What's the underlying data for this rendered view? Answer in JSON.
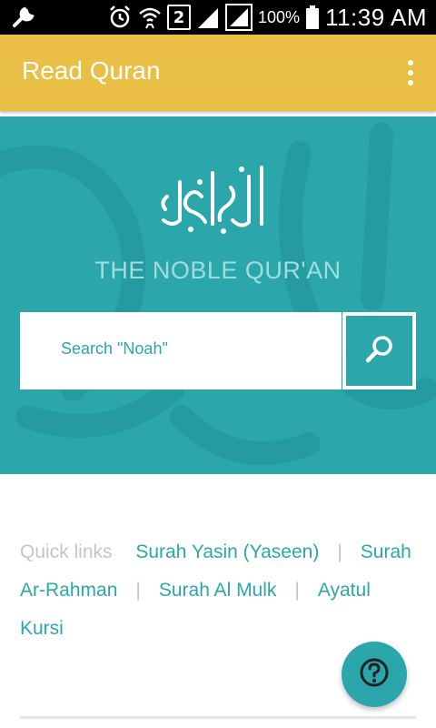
{
  "status_bar": {
    "battery": "100%",
    "time": "11:39 AM",
    "sim_badge": "2",
    "icons": [
      "wrench-icon",
      "alarm-icon",
      "wifi-icon",
      "signal-icon",
      "signal-icon",
      "battery-icon"
    ]
  },
  "app_bar": {
    "title": "Read Quran",
    "menu_icon": "overflow-menu-icon",
    "color": "#e9bf46"
  },
  "hero": {
    "logo_text": "القرآن الكريم",
    "subtitle": "THE NOBLE QUR'AN",
    "color": "#2ba7ac"
  },
  "search": {
    "placeholder": "Search \"Noah\"",
    "value": "",
    "button_icon": "search-icon"
  },
  "quick_links": {
    "label": "Quick links",
    "separator": "|",
    "items": [
      {
        "label": "Surah Yasin (Yaseen)"
      },
      {
        "label": "Surah Ar-Rahman"
      },
      {
        "label": "Surah Al Mulk"
      },
      {
        "label": "Ayatul Kursi"
      }
    ]
  },
  "help_button": {
    "icon": "help-icon"
  }
}
